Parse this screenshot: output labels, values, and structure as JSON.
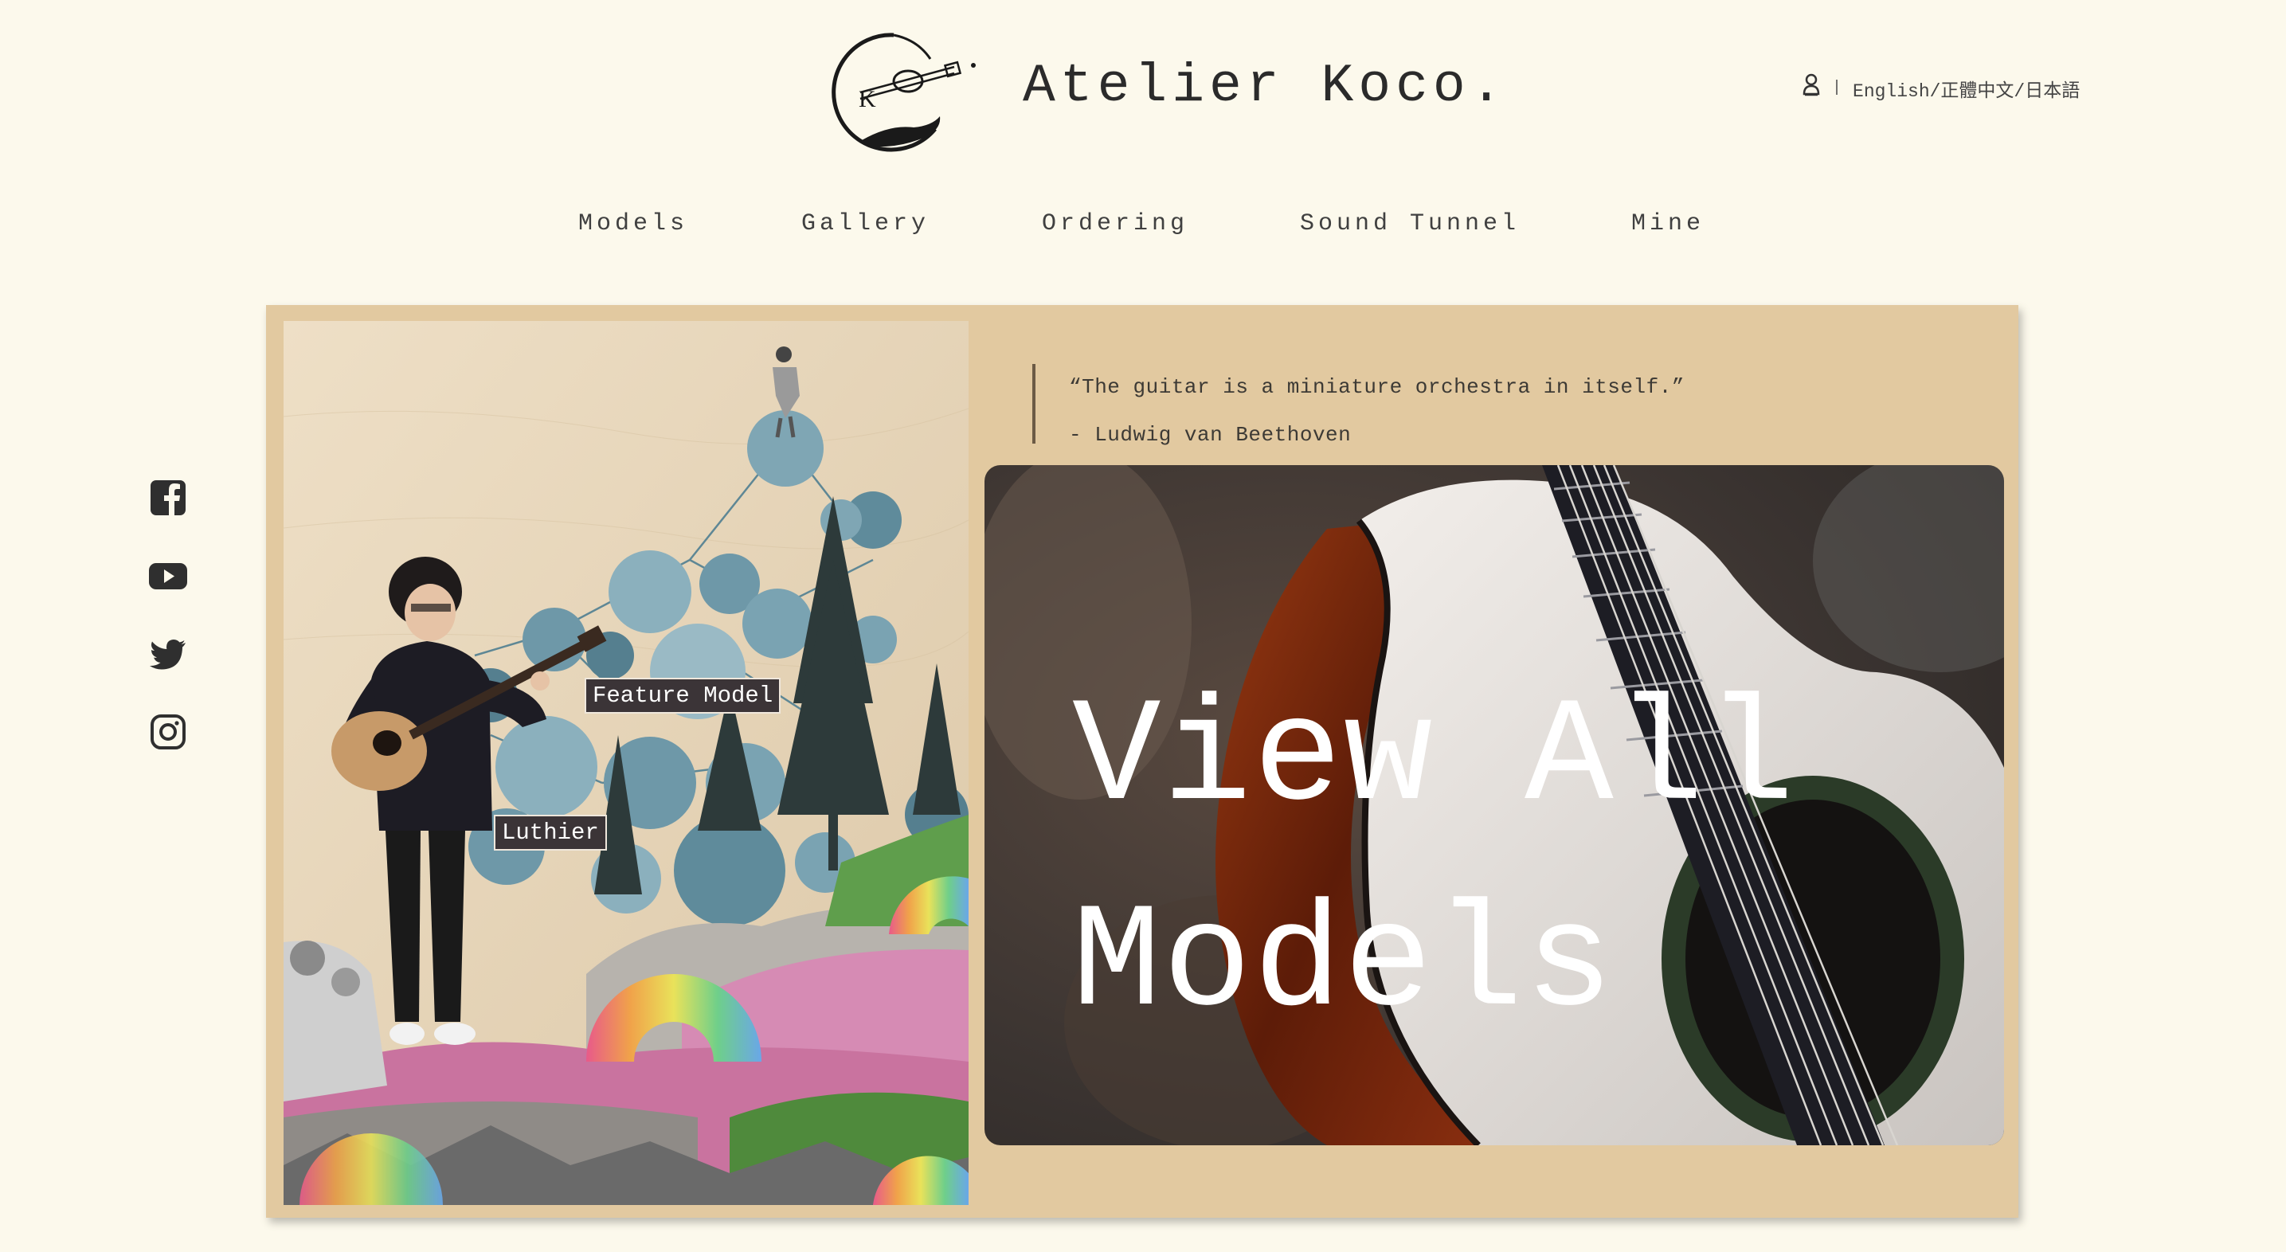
{
  "header": {
    "brand": "Atelier Koco.",
    "logo_icon": "guitar-circle-logo",
    "languages_separator": "|",
    "languages": "English/正體中文/日本語",
    "user_icon": "user-icon"
  },
  "nav": {
    "items": [
      {
        "label": "Models"
      },
      {
        "label": "Gallery"
      },
      {
        "label": "Ordering"
      },
      {
        "label": "Sound Tunnel"
      },
      {
        "label": "Mine"
      }
    ]
  },
  "social": [
    {
      "icon": "facebook-icon"
    },
    {
      "icon": "youtube-icon"
    },
    {
      "icon": "twitter-icon"
    },
    {
      "icon": "instagram-icon"
    }
  ],
  "feature": {
    "tags": [
      {
        "label": "Feature Model"
      },
      {
        "label": "Luthier"
      }
    ]
  },
  "quote": {
    "text": "“The guitar is a miniature orchestra in itself.”",
    "author": "- Ludwig van Beethoven"
  },
  "hero": {
    "line1": "View All",
    "line2": "Models"
  },
  "colors": {
    "background": "#fcf9ec",
    "panel": "#e2c9a0",
    "text": "#3a3a3a"
  }
}
